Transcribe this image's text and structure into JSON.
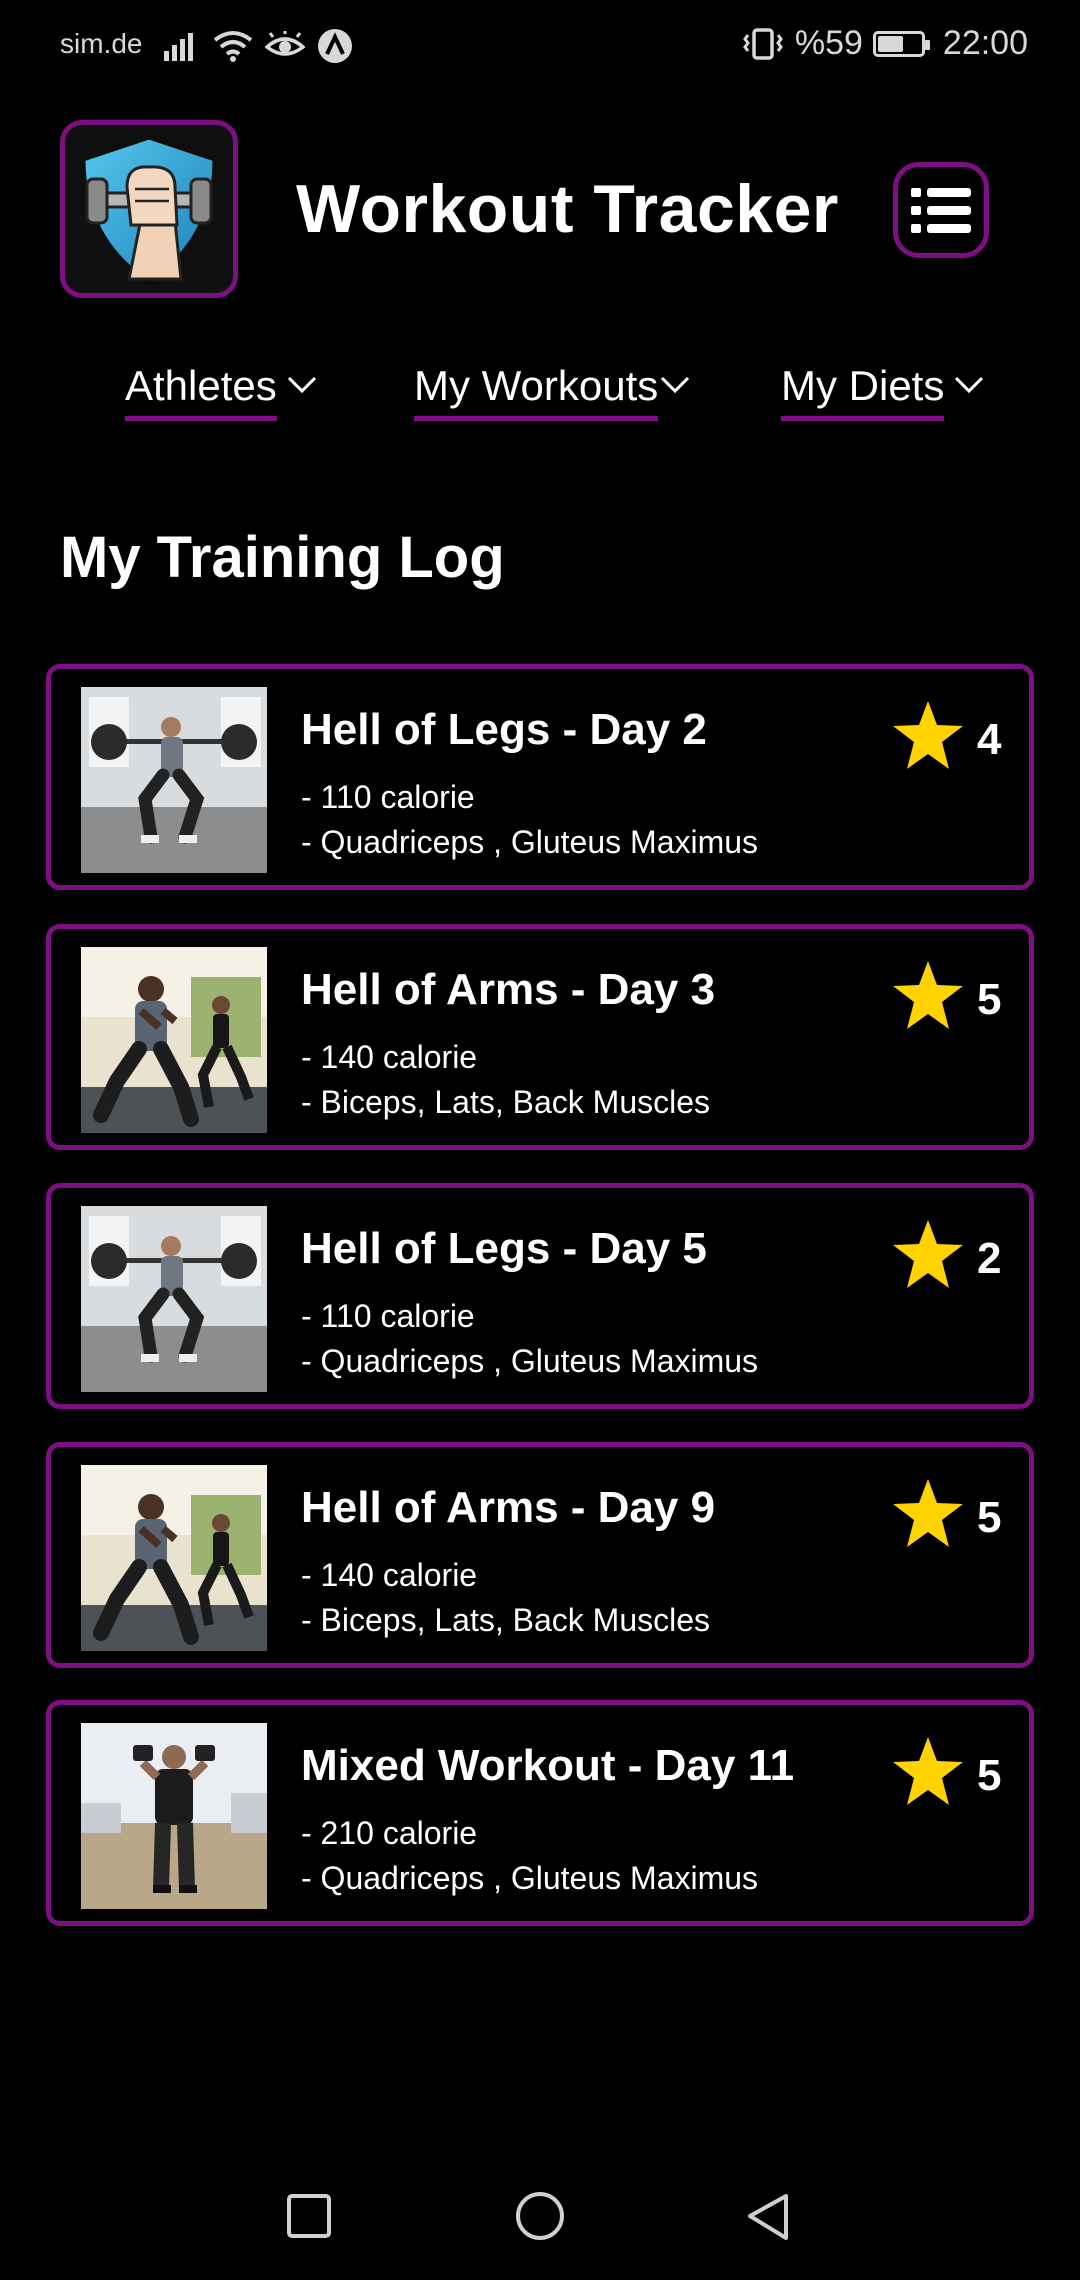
{
  "status_bar": {
    "carrier": "sim.de",
    "battery_text": "%59",
    "battery_level": 0.59,
    "time": "22:00",
    "icons": [
      "signal-icon",
      "wifi-icon",
      "eye-icon",
      "app-a-icon",
      "vibrate-icon",
      "battery-icon"
    ]
  },
  "header": {
    "title": "Workout Tracker",
    "logo_icon": "dumbbell-shield-logo",
    "menu_icon": "list-menu-icon"
  },
  "nav": {
    "items": [
      {
        "label": "Athletes"
      },
      {
        "label": "My Workouts"
      },
      {
        "label": "My Diets"
      }
    ]
  },
  "section": {
    "title": "My Training Log"
  },
  "workouts": [
    {
      "title": "Hell of Legs - Day 2",
      "calories": "- 110 calorie",
      "muscles": "- Quadriceps , Gluteus Maximus",
      "rating": "4",
      "image": "squat-barbell"
    },
    {
      "title": "Hell of Arms - Day 3",
      "calories": "- 140 calorie",
      "muscles": "- Biceps, Lats, Back Muscles",
      "rating": "5",
      "image": "lunge-pair"
    },
    {
      "title": "Hell of Legs - Day 5",
      "calories": "- 110 calorie",
      "muscles": "- Quadriceps , Gluteus Maximus",
      "rating": "2",
      "image": "squat-barbell"
    },
    {
      "title": "Hell of Arms - Day 9",
      "calories": "- 140 calorie",
      "muscles": "- Biceps, Lats, Back Muscles",
      "rating": "5",
      "image": "lunge-pair"
    },
    {
      "title": "Mixed Workout - Day 11",
      "calories": "- 210 calorie",
      "muscles": "- Quadriceps , Gluteus Maximus",
      "rating": "5",
      "image": "dumbbell-standing"
    }
  ],
  "colors": {
    "accent": "#7d0f82",
    "star": "#ffd200",
    "background": "#000000"
  },
  "system_nav": [
    "recents-square-icon",
    "home-circle-icon",
    "back-triangle-icon"
  ]
}
